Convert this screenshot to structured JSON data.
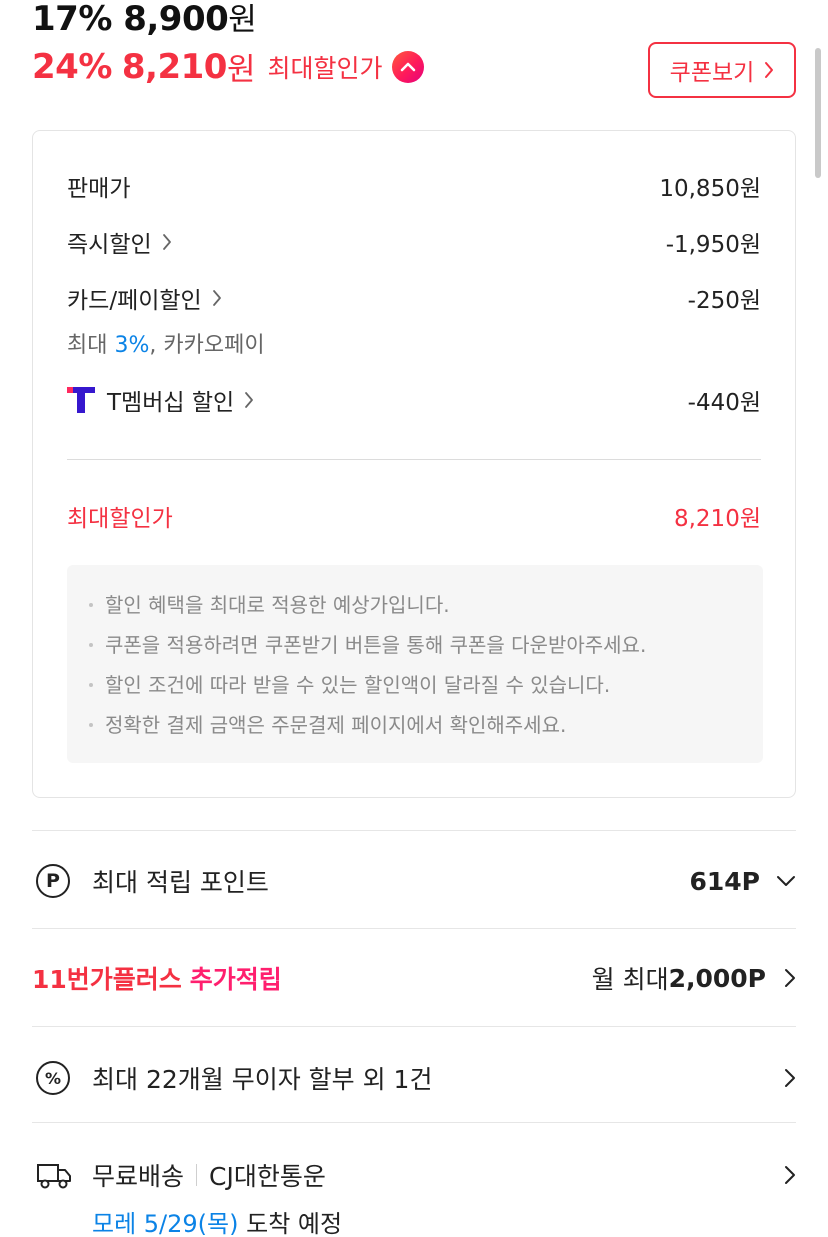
{
  "price": {
    "first_pct": "17%",
    "first_amount": "8,900",
    "won": "원",
    "max_pct": "24%",
    "max_amount": "8,210",
    "max_label": "최대할인가"
  },
  "coupon_button": {
    "label": "쿠폰보기"
  },
  "breakdown": {
    "sale_price": {
      "label": "판매가",
      "value": "10,850원"
    },
    "instant": {
      "label": "즉시할인",
      "value": "-1,950원"
    },
    "card": {
      "label": "카드/페이할인",
      "value": "-250원",
      "note_prefix": "최대 ",
      "note_rate": "3%",
      "note_suffix": ", 카카오페이"
    },
    "tmembership": {
      "label": "T멤버십 할인",
      "value": "-440원"
    },
    "max_price": {
      "label": "최대할인가",
      "value": "8,210원"
    },
    "notes": [
      "할인 혜택을 최대로 적용한 예상가입니다.",
      "쿠폰을 적용하려면 쿠폰받기 버튼을 통해 쿠폰을 다운받아주세요.",
      "할인 조건에 따라 받을 수 있는 할인액이 달라질 수 있습니다.",
      "정확한 결제 금액은 주문결제 페이지에서 확인해주세요."
    ]
  },
  "points": {
    "icon_text": "P",
    "label": "최대 적립 포인트",
    "value": "614P"
  },
  "plus": {
    "brand": "11번가플러스",
    "label": "추가적립",
    "value_prefix": "월 최대 ",
    "value": "2,000P"
  },
  "installment": {
    "icon_text": "%",
    "label": "최대 22개월 무이자 할부 외 1건"
  },
  "shipping": {
    "label": "무료배송",
    "carrier": "CJ대한통운",
    "eta_date": "모레 5/29(목)",
    "eta_suffix": " 도착 예정"
  },
  "colors": {
    "accent_red": "#f43142",
    "link_blue": "#0b83e6",
    "plus_pink": "#ff1f6e"
  }
}
